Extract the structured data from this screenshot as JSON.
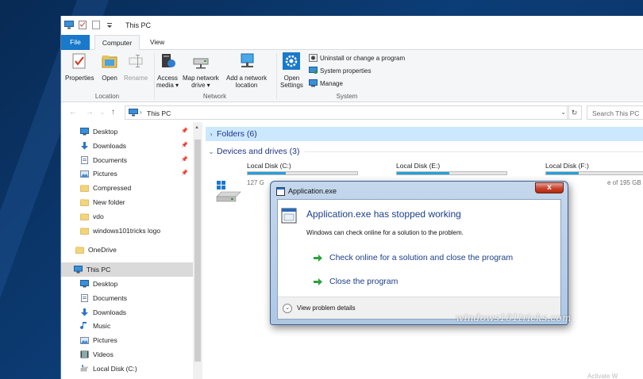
{
  "window": {
    "title": "This PC"
  },
  "tabs": {
    "file": "File",
    "computer": "Computer",
    "view": "View"
  },
  "ribbon": {
    "location": {
      "group": "Location",
      "properties": "Properties",
      "open": "Open",
      "rename": "Rename"
    },
    "network": {
      "group": "Network",
      "access_media": [
        "Access",
        "media ▾"
      ],
      "map_drive": [
        "Map network",
        "drive ▾"
      ],
      "add_location": [
        "Add a network",
        "location"
      ]
    },
    "system": {
      "group": "System",
      "open_settings": [
        "Open",
        "Settings"
      ],
      "uninstall": "Uninstall or change a program",
      "system_properties": "System properties",
      "manage": "Manage"
    }
  },
  "address": {
    "path": "This PC",
    "search_placeholder": "Search This PC"
  },
  "nav": {
    "items": [
      {
        "label": "Desktop",
        "icon": "desktop-icon",
        "pinned": true
      },
      {
        "label": "Downloads",
        "icon": "download-icon",
        "pinned": true
      },
      {
        "label": "Documents",
        "icon": "documents-icon",
        "pinned": true
      },
      {
        "label": "Pictures",
        "icon": "pictures-icon",
        "pinned": true
      },
      {
        "label": "Compressed",
        "icon": "folder-icon",
        "pinned": false
      },
      {
        "label": "New folder",
        "icon": "folder-icon",
        "pinned": false
      },
      {
        "label": "vdo",
        "icon": "folder-icon",
        "pinned": false
      },
      {
        "label": "windows101tricks logo",
        "icon": "folder-icon",
        "pinned": false
      },
      {
        "label": "OneDrive",
        "icon": "onedrive-folder-icon",
        "pinned": false
      },
      {
        "label": "This PC",
        "icon": "computer-icon",
        "pinned": false,
        "selected": true
      },
      {
        "label": "Desktop",
        "icon": "desktop-icon",
        "pinned": false
      },
      {
        "label": "Documents",
        "icon": "documents-icon",
        "pinned": false
      },
      {
        "label": "Downloads",
        "icon": "download-icon",
        "pinned": false
      },
      {
        "label": "Music",
        "icon": "music-icon",
        "pinned": false
      },
      {
        "label": "Pictures",
        "icon": "pictures-icon",
        "pinned": false
      },
      {
        "label": "Videos",
        "icon": "videos-icon",
        "pinned": false
      },
      {
        "label": "Local Disk (C:)",
        "icon": "drive-icon",
        "pinned": false
      }
    ],
    "pin_glyph": "📌"
  },
  "content": {
    "folders_header": "Folders (6)",
    "devices_header": "Devices and drives (3)",
    "drives": [
      {
        "name": "Local Disk (C:)",
        "used_fraction": 0.35,
        "info": "127 G"
      },
      {
        "name": "Local Disk (E:)",
        "used_fraction": 0.48,
        "info": ""
      },
      {
        "name": "Local Disk (F:)",
        "used_fraction": 0.3,
        "info": "e of 195 GB"
      }
    ]
  },
  "dialog": {
    "title": "Application.exe",
    "close": "x",
    "heading": "Application.exe has stopped working",
    "description": "Windows can check online for a solution to the problem.",
    "option1": "Check online for a solution and close the program",
    "option2": "Close the program",
    "details": "View problem details"
  },
  "watermark": "windows101tricks.com",
  "activate": "Activate W",
  "colors": {
    "accent": "#1979ca",
    "selection": "#cce8ff",
    "link": "#1b3e8a",
    "arrow": "#2aa33a"
  }
}
